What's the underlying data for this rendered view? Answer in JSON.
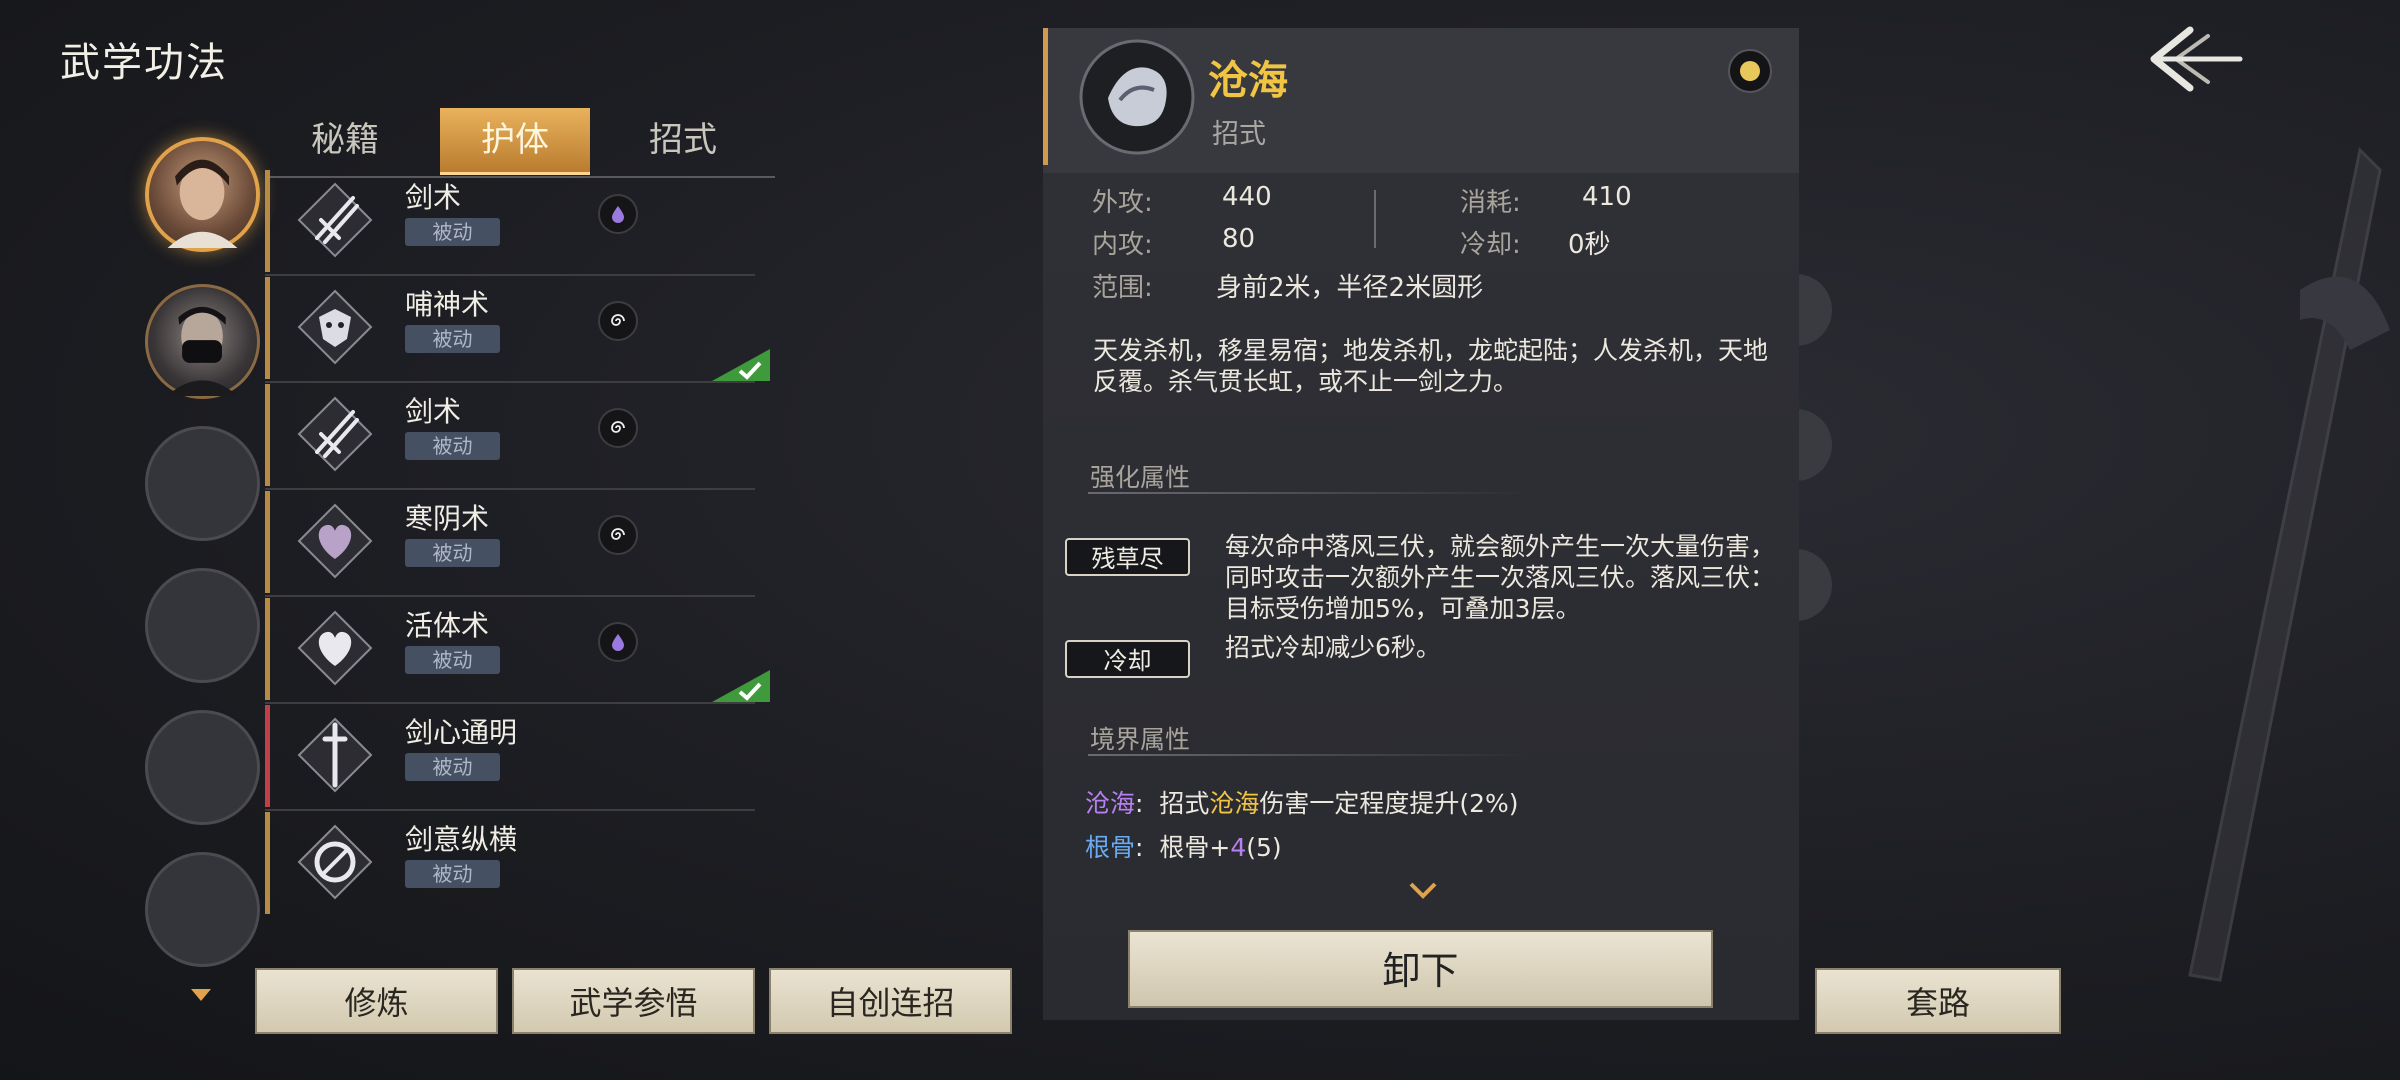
{
  "header": {
    "title": "武学功法"
  },
  "tabs": [
    {
      "label": "秘籍",
      "active": false
    },
    {
      "label": "护体",
      "active": true
    },
    {
      "label": "招式",
      "active": false
    }
  ],
  "skills": [
    {
      "name": "剑术",
      "tag": "被动",
      "badge": "purple-drop-icon",
      "equipped": false,
      "accent": "gold"
    },
    {
      "name": "哺神术",
      "tag": "被动",
      "badge": "spiral-icon",
      "equipped": true,
      "accent": "gold"
    },
    {
      "name": "剑术",
      "tag": "被动",
      "badge": "spiral-icon",
      "equipped": false,
      "accent": "gold"
    },
    {
      "name": "寒阴术",
      "tag": "被动",
      "badge": "spiral-icon",
      "equipped": false,
      "accent": "gold"
    },
    {
      "name": "活体术",
      "tag": "被动",
      "badge": "purple-drop-icon",
      "equipped": true,
      "accent": "gold"
    },
    {
      "name": "剑心通明",
      "tag": "被动",
      "badge": "",
      "equipped": false,
      "accent": "red"
    },
    {
      "name": "剑意纵横",
      "tag": "被动",
      "badge": "",
      "equipped": false,
      "accent": "gold"
    }
  ],
  "bottom_buttons": {
    "train": "修炼",
    "comprehend": "武学参悟",
    "combo": "自创连招"
  },
  "detail": {
    "name": "沧海",
    "type": "招式",
    "stats": {
      "outer_attack_label": "外攻:",
      "outer_attack": "440",
      "inner_attack_label": "内攻:",
      "inner_attack": "80",
      "cost_label": "消耗:",
      "cost": "410",
      "cooldown_label": "冷却:",
      "cooldown": "0秒",
      "range_label": "范围:",
      "range": "身前2米，半径2米圆形"
    },
    "description": "天发杀机，移星易宿；地发杀机，龙蛇起陆；人发杀机，天地反覆。杀气贯长虹，或不止一剑之力。",
    "enhance_title": "强化属性",
    "enhance": [
      {
        "tag": "残草尽",
        "text": "每次命中落风三伏，就会额外产生一次大量伤害，同时攻击一次额外产生一次落风三伏。落风三伏：目标受伤增加5%，可叠加3层。"
      },
      {
        "tag": "冷却",
        "text": "招式冷却减少6秒。"
      }
    ],
    "realm_title": "境界属性",
    "realm": [
      {
        "key": "沧海",
        "sep": ":",
        "pre": "招式",
        "mid": "沧海",
        "post": "伤害一定程度提升(2%)"
      },
      {
        "key": "根骨",
        "sep": ":",
        "pre": "根骨+",
        "mid": "4",
        "post": "(5)"
      }
    ],
    "unequip_label": "卸下"
  },
  "route_button": "套路",
  "colors": {
    "accent_gold": "#e0a24a",
    "name_gold": "#f1c542",
    "purple": "#b780f0",
    "blue": "#6aaaf0"
  }
}
